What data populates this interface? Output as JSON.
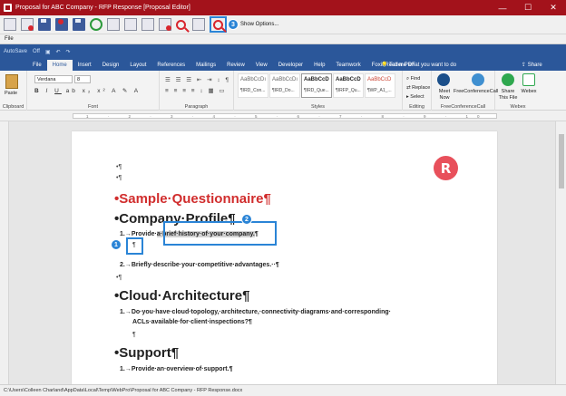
{
  "window": {
    "title": "Proposal for ABC Company - RFP Response [Proposal Editor]",
    "controls": [
      "—",
      "☐",
      "✕"
    ]
  },
  "toolbar": {
    "badge3": "3",
    "show_options": "Show Options..."
  },
  "menubar": {
    "file": "File"
  },
  "word": {
    "qat_autosave": "AutoSave",
    "qat_off": "Off",
    "tabs": [
      "File",
      "Home",
      "Insert",
      "Design",
      "Layout",
      "References",
      "Mailings",
      "Review",
      "View",
      "Developer",
      "Help",
      "Teamwork",
      "Foxit Reader PDF"
    ],
    "active_tab": "Home",
    "tell_me": "💡 Tell me what you want to do",
    "share": "Share"
  },
  "ribbon": {
    "clipboard": {
      "label": "Clipboard",
      "paste": "Paste"
    },
    "font": {
      "label": "Font",
      "name": "Verdana",
      "size": "8"
    },
    "paragraph": {
      "label": "Paragraph"
    },
    "styles": {
      "label": "Styles",
      "items": [
        {
          "preview": "AaBbCcDı",
          "name": "¶IRD_Con..."
        },
        {
          "preview": "AaBbCcDı",
          "name": "¶IRD_Do..."
        },
        {
          "preview": "AaBbCcD",
          "name": "¶IRD_Que..."
        },
        {
          "preview": "AaBbCcD",
          "name": "¶IRFP_Qu..."
        },
        {
          "preview": "AaBbCcD",
          "name": "¶WP_A1_..."
        }
      ]
    },
    "editing": {
      "label": "Editing",
      "find": "Find",
      "replace": "Replace",
      "select": "Select"
    },
    "conference": {
      "label": "FreeConferenceCall",
      "meet": "Meet Now",
      "fcc": "FreeConferenceCall"
    },
    "webex": {
      "label": "Webex",
      "share": "Share This File",
      "webex": "Webex"
    }
  },
  "document": {
    "logo_letter": "R",
    "pilcrow": "¶",
    "bullet_pilcrow": "•¶",
    "title": "•Sample·Questionnaire¶",
    "h_company": "•Company·Profile¶",
    "q1_prefix": "1.→Provide·",
    "q1_selected": "a·brief·history·of·your·company.",
    "q1_suffix": "¶",
    "q2": "2.→Briefly·describe·your·competitive·advantages.··¶",
    "h_cloud": "•Cloud·Architecture¶",
    "q3_line1": "1.→Do·you·have·cloud·topology,·architecture,·connectivity·diagrams·and·corresponding·",
    "q3_line2": "ACLs·available·for·client·inspections?¶",
    "h_support": "•Support¶",
    "q4": "1.→Provide·an·overview·of·support.¶",
    "badge1": "1",
    "badge2": "2"
  },
  "status": {
    "path": "C:\\Users\\Colleen Charland\\AppData\\Local\\Temp\\WebPro\\Proposal for ABC Company - RFP Response.docx"
  },
  "colors": {
    "title_bar": "#a3121b",
    "word_blue": "#2b579a",
    "callout_blue": "#2a84d6",
    "heading_red": "#d12d2d"
  }
}
